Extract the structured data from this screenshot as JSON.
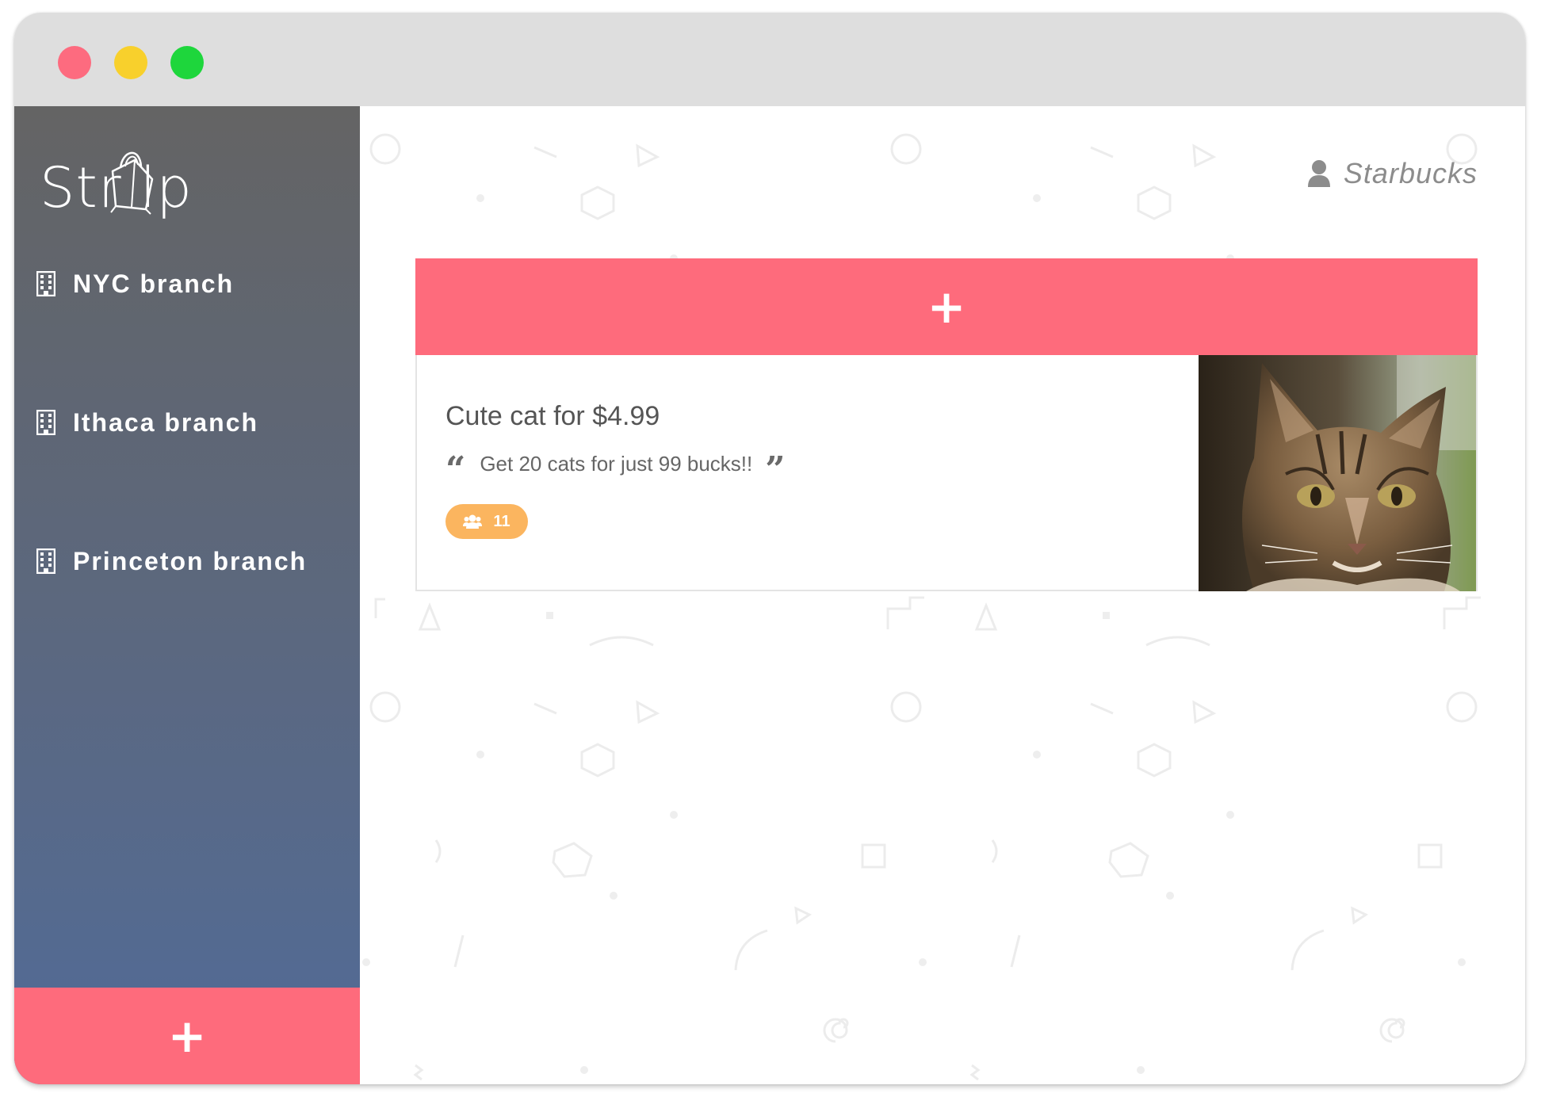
{
  "window": {
    "traffic_lights": [
      "close",
      "minimize",
      "maximize"
    ]
  },
  "sidebar": {
    "logo_text": "Str lp",
    "items": [
      {
        "label": "NYC branch",
        "icon": "building-icon"
      },
      {
        "label": "Ithaca branch",
        "icon": "building-icon"
      },
      {
        "label": "Princeton branch",
        "icon": "building-icon"
      }
    ],
    "add_button": {
      "icon": "plus-icon",
      "symbol": "+"
    }
  },
  "header": {
    "user_name": "Starbucks",
    "user_icon": "user-icon"
  },
  "main": {
    "add_button": {
      "icon": "plus-icon",
      "symbol": "+"
    },
    "cards": [
      {
        "title": "Cute cat for $4.99",
        "quote": "Get 20 cats for just 99 bucks!!",
        "quote_open": "“",
        "quote_close": "”",
        "badge_icon": "users-icon",
        "badge_count": "11",
        "image": "cat-photo"
      }
    ]
  },
  "colors": {
    "accent": "#fe6b7c",
    "badge": "#fbb55f",
    "sidebar_top": "#646464",
    "sidebar_bottom": "#516b98",
    "titlebar": "#dedede"
  }
}
